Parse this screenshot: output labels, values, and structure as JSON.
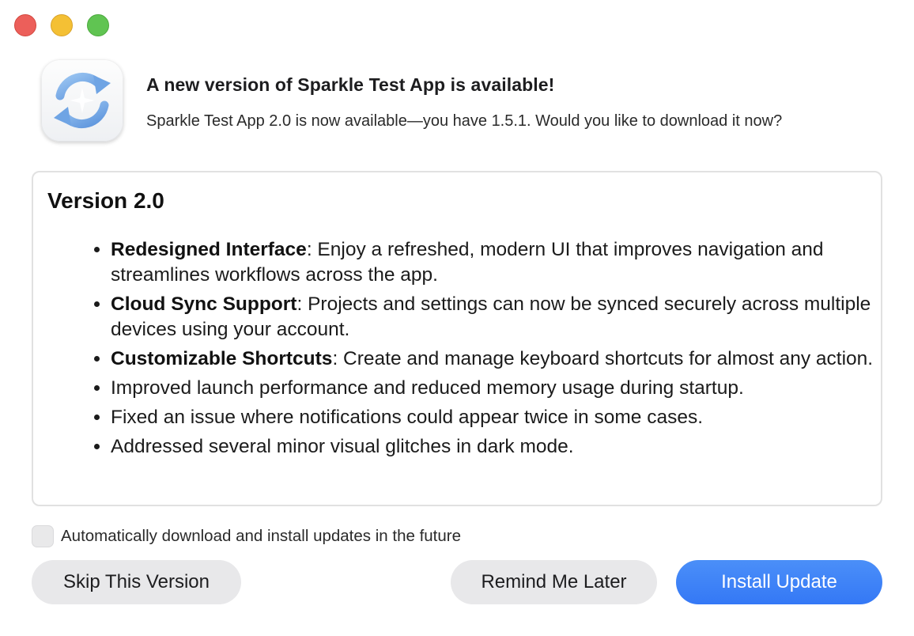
{
  "window": {
    "traffic_lights": [
      "close",
      "minimize",
      "zoom"
    ]
  },
  "app_icon": "sparkle-update-icon",
  "header": {
    "title": "A new version of Sparkle Test App is available!",
    "subtitle": "Sparkle Test App 2.0 is now available—you have 1.5.1. Would you like to download it now?"
  },
  "release_notes": {
    "heading": "Version 2.0",
    "items": [
      {
        "bold": "Redesigned Interface",
        "text": ": Enjoy a refreshed, modern UI that improves navigation and streamlines workflows across the app."
      },
      {
        "bold": "Cloud Sync Support",
        "text": ": Projects and settings can now be synced securely across multiple devices using your account."
      },
      {
        "bold": "Customizable Shortcuts",
        "text": ": Create and manage keyboard shortcuts for almost any action."
      },
      {
        "bold": "",
        "text": "Improved launch performance and reduced memory usage during startup."
      },
      {
        "bold": "",
        "text": "Fixed an issue where notifications could appear twice in some cases."
      },
      {
        "bold": "",
        "text": "Addressed several minor visual glitches in dark mode."
      }
    ]
  },
  "auto_update": {
    "label": "Automatically download and install updates in the future",
    "checked": false
  },
  "buttons": {
    "skip": "Skip This Version",
    "remind": "Remind Me Later",
    "install": "Install Update"
  },
  "colors": {
    "accent": "#3478f6",
    "close": "#ec5f5a",
    "minimize": "#f4c034",
    "zoom": "#60c452"
  }
}
